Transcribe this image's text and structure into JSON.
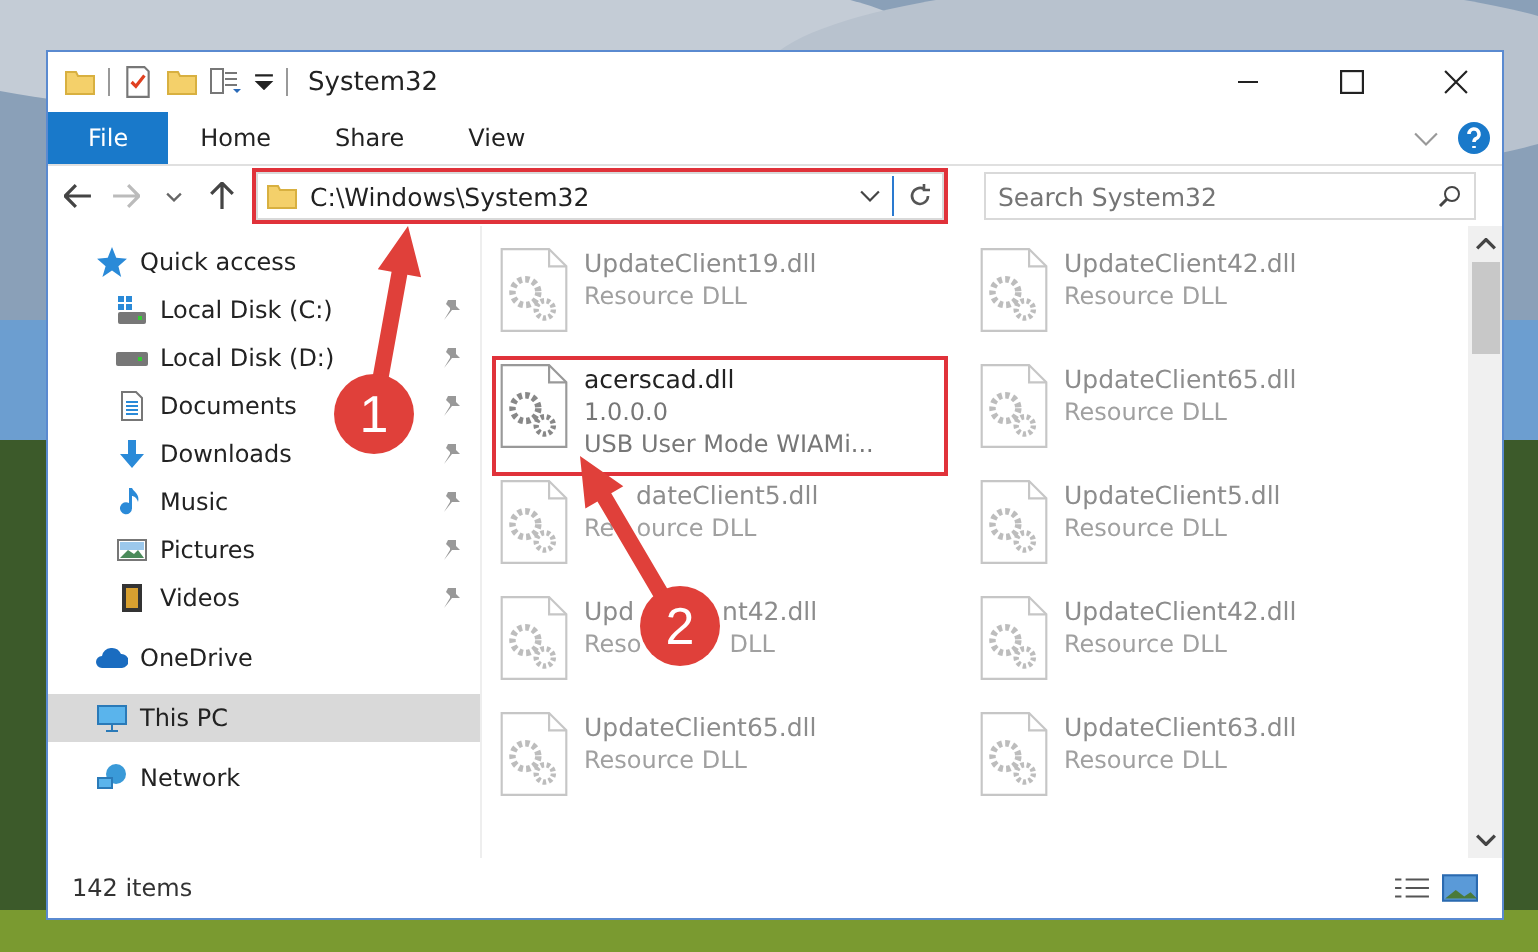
{
  "window": {
    "title": "System32"
  },
  "ribbon_tabs": [
    {
      "label": "File",
      "selected": true
    },
    {
      "label": "Home",
      "selected": false
    },
    {
      "label": "Share",
      "selected": false
    },
    {
      "label": "View",
      "selected": false
    }
  ],
  "address_bar": {
    "path": "C:\\Windows\\System32",
    "highlighted": true
  },
  "search": {
    "placeholder": "Search System32"
  },
  "sidebar": {
    "items": [
      {
        "label": "Quick access",
        "selected": false,
        "children": [
          {
            "label": "Local Disk (C:)",
            "pinned": true
          },
          {
            "label": "Local Disk (D:)",
            "pinned": true
          },
          {
            "label": "Documents",
            "pinned": true
          },
          {
            "label": "Downloads",
            "pinned": true
          },
          {
            "label": "Music",
            "pinned": true
          },
          {
            "label": "Pictures",
            "pinned": true
          },
          {
            "label": "Videos",
            "pinned": true
          }
        ]
      },
      {
        "label": "OneDrive",
        "selected": false
      },
      {
        "label": "This PC",
        "selected": true
      },
      {
        "label": "Network",
        "selected": false
      }
    ]
  },
  "files": [
    {
      "kind": "plain",
      "name": [
        "UpdateClient19.dll"
      ],
      "lines": [
        [
          "Resource DLL"
        ]
      ],
      "highlighted": false
    },
    {
      "kind": "plain",
      "name": [
        "UpdateClient42.dll"
      ],
      "lines": [
        [
          "Resource DLL"
        ]
      ],
      "highlighted": false
    },
    {
      "kind": "plain",
      "name": [
        "acerscad.dll"
      ],
      "lines": [
        [
          "1.0.0.0"
        ],
        [
          "USB User Mode WIAMi..."
        ]
      ],
      "highlighted": true
    },
    {
      "kind": "plain",
      "name": [
        "UpdateClient65.dll"
      ],
      "lines": [
        [
          "Resource DLL"
        ]
      ],
      "highlighted": false
    },
    {
      "kind": "under-arrow",
      "name": [
        "dateClient5.dll"
      ],
      "lines": [
        [
          "Re",
          "ource DLL"
        ]
      ],
      "highlighted": false
    },
    {
      "kind": "plain",
      "name": [
        "UpdateClient5.dll"
      ],
      "lines": [
        [
          "Resource DLL"
        ]
      ],
      "highlighted": false
    },
    {
      "kind": "under-badge",
      "name": [
        "Upd",
        "nt42.dll"
      ],
      "lines": [
        [
          "Reso",
          "DLL"
        ]
      ],
      "highlighted": false
    },
    {
      "kind": "plain",
      "name": [
        "UpdateClient42.dll"
      ],
      "lines": [
        [
          "Resource DLL"
        ]
      ],
      "highlighted": false
    },
    {
      "kind": "plain",
      "name": [
        "UpdateClient65.dll"
      ],
      "lines": [
        [
          "Resource DLL"
        ]
      ],
      "highlighted": false
    },
    {
      "kind": "plain",
      "name": [
        "UpdateClient63.dll"
      ],
      "lines": [
        [
          "Resource DLL"
        ]
      ],
      "highlighted": false
    }
  ],
  "status_bar": {
    "count": "142 items"
  },
  "annotations": [
    {
      "number": "1"
    },
    {
      "number": "2"
    }
  ]
}
